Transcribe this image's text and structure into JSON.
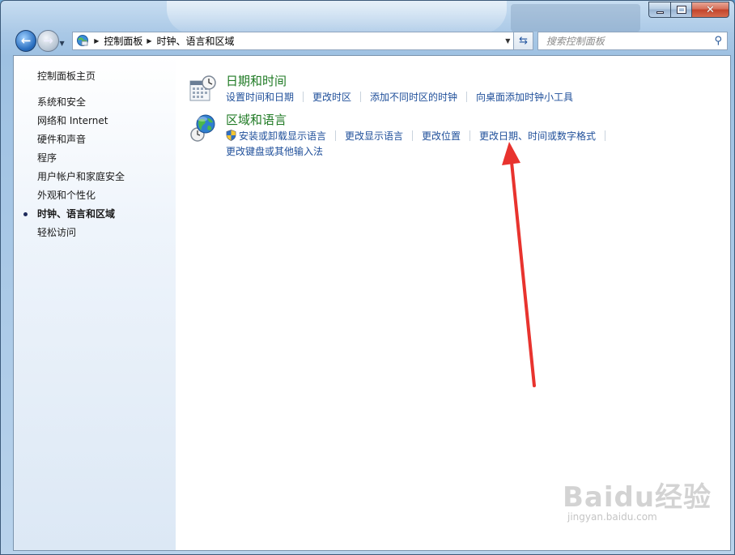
{
  "window": {
    "caption_buttons": {
      "minimize": "minimize",
      "maximize": "maximize",
      "close": "✕"
    }
  },
  "nav": {
    "back": "back",
    "forward": "forward",
    "address": {
      "segments": [
        "控制面板",
        "时钟、语言和区域"
      ]
    },
    "refresh_icon": "refresh-icon",
    "search_placeholder": "搜索控制面板"
  },
  "sidebar": {
    "home": "控制面板主页",
    "items": [
      {
        "label": "系统和安全",
        "active": false
      },
      {
        "label": "网络和 Internet",
        "active": false
      },
      {
        "label": "硬件和声音",
        "active": false
      },
      {
        "label": "程序",
        "active": false
      },
      {
        "label": "用户帐户和家庭安全",
        "active": false
      },
      {
        "label": "外观和个性化",
        "active": false
      },
      {
        "label": "时钟、语言和区域",
        "active": true
      },
      {
        "label": "轻松访问",
        "active": false
      }
    ]
  },
  "categories": [
    {
      "title": "日期和时间",
      "icon": "calendar-clock-icon",
      "links": [
        "设置时间和日期",
        "更改时区",
        "添加不同时区的时钟",
        "向桌面添加时钟小工具"
      ]
    },
    {
      "title": "区域和语言",
      "icon": "globe-clock-icon",
      "links": [
        "安装或卸载显示语言",
        "更改显示语言",
        "更改位置",
        "更改日期、时间或数字格式"
      ],
      "links_row2": [
        "更改键盘或其他输入法"
      ]
    }
  ],
  "colors": {
    "link": "#1f4f9a",
    "category_title": "#1f7a24",
    "annotation_arrow": "#e8332e"
  },
  "watermark": {
    "main": "Baidu经验",
    "sub": "jingyan.baidu.com"
  }
}
